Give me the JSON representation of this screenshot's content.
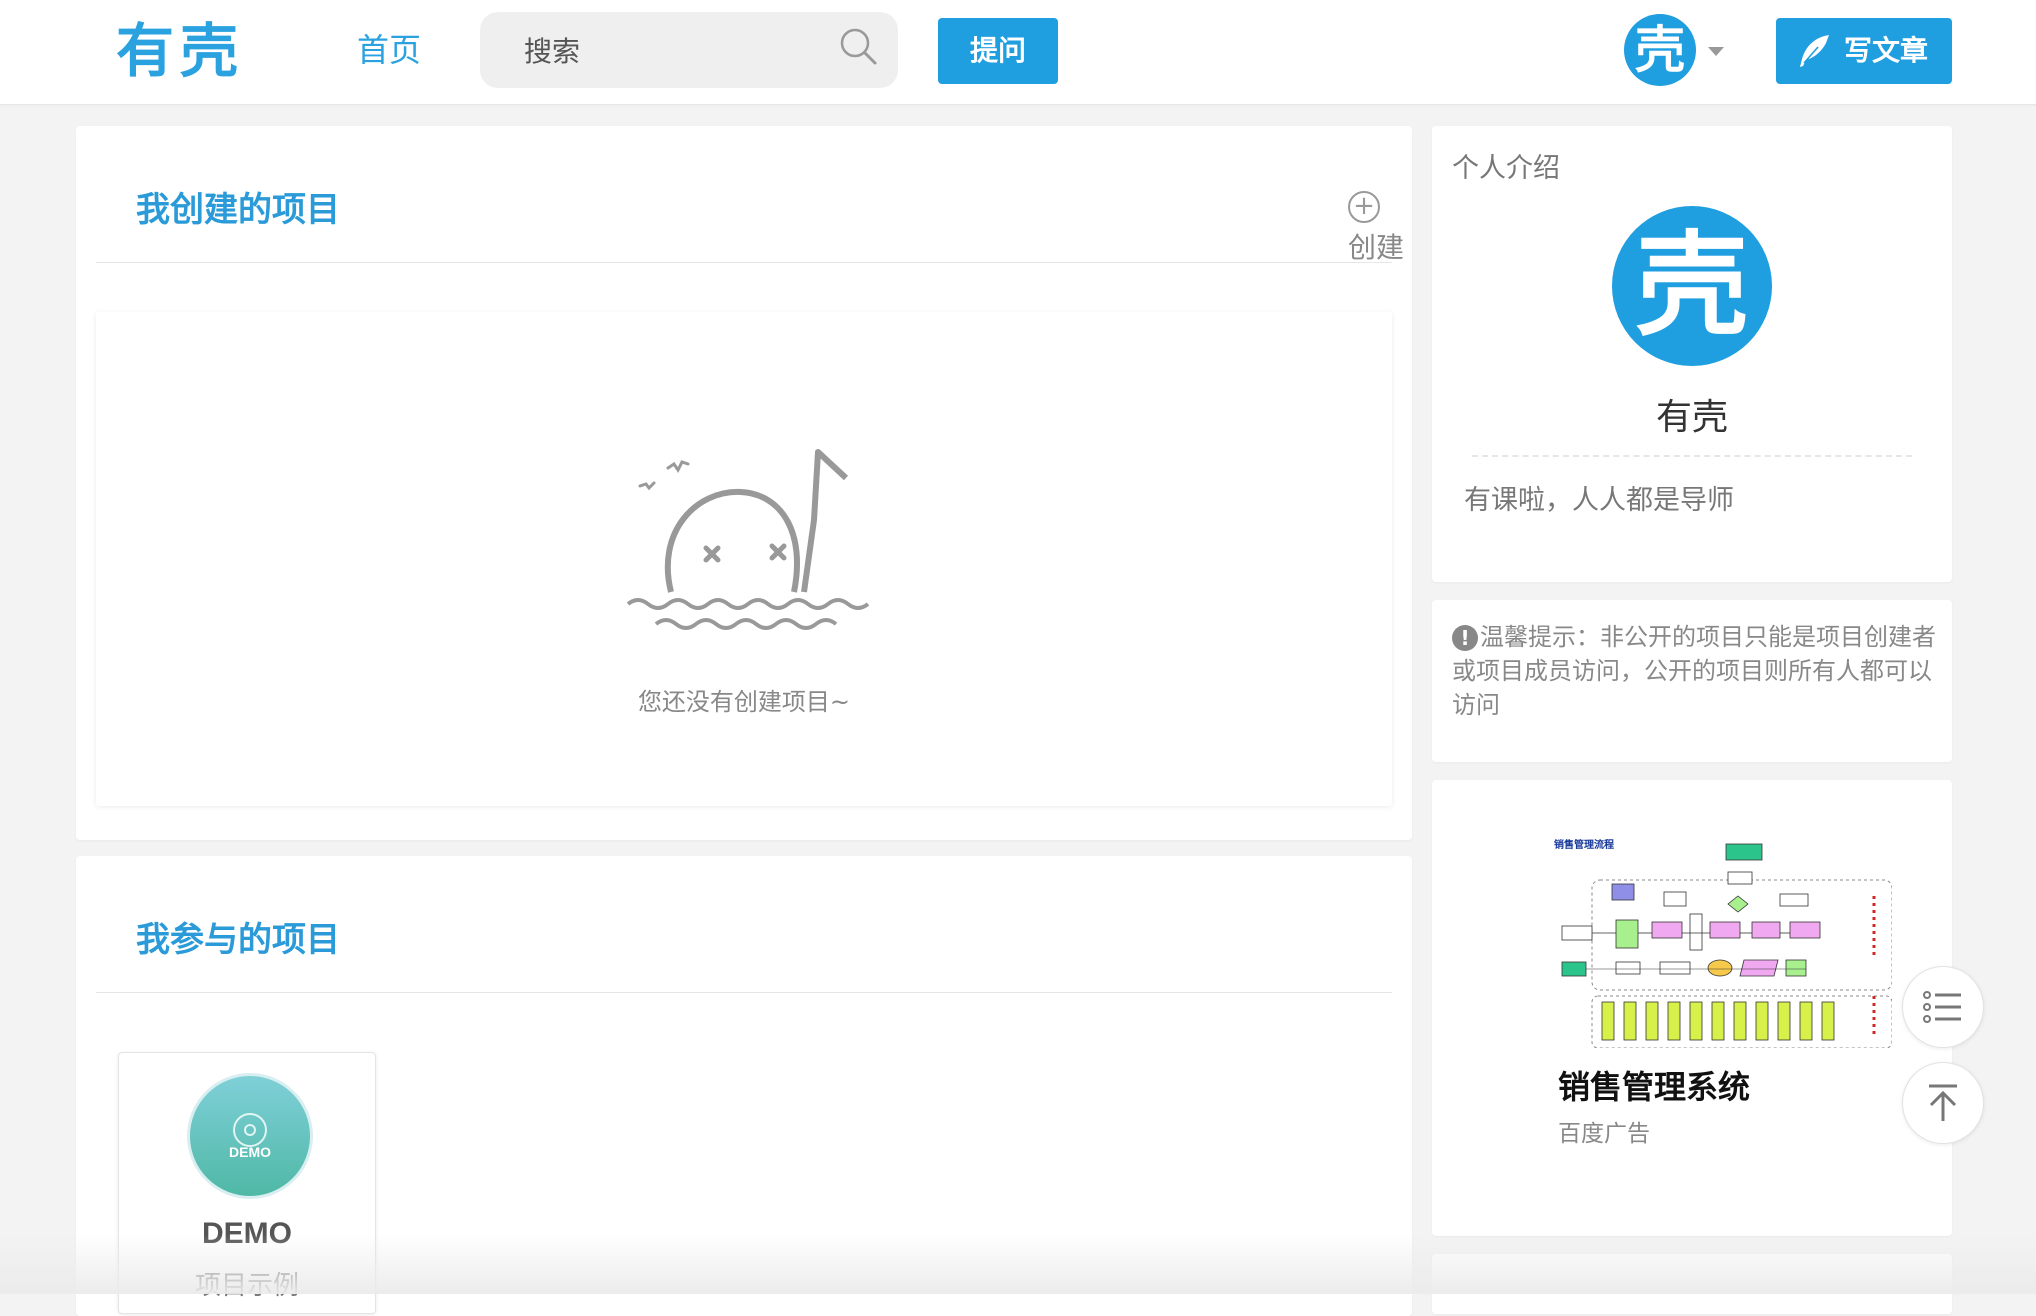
{
  "header": {
    "logo_text": "有壳",
    "nav_home": "首页",
    "search_placeholder": "搜索",
    "ask_button": "提问",
    "avatar_text": "壳",
    "write_button": "写文章"
  },
  "main": {
    "created_section_title": "我创建的项目",
    "create_link": "创建",
    "empty_text": "您还没有创建项目~",
    "joined_section_title": "我参与的项目",
    "projects": [
      {
        "name": "DEMO",
        "desc": "项目示例",
        "logo_text": "DEMO"
      }
    ]
  },
  "sidebar": {
    "intro_title": "个人介绍",
    "avatar_text": "壳",
    "name": "有壳",
    "bio": "有课啦，人人都是导师",
    "tip_icon": "!",
    "tip": "温馨提示：非公开的项目只能是项目创建者或项目成员访问，公开的项目则所有人都可以访问",
    "ad": {
      "image_title": "销售管理流程",
      "title": "销售管理系统",
      "source": "百度广告"
    }
  },
  "icons": {
    "search": "search-icon",
    "feather": "feather-icon",
    "list": "list-icon",
    "back_to_top": "arrow-up-icon"
  },
  "colors": {
    "brand": "#1f9ee0",
    "title": "#2a9ad8",
    "background": "#f3f3f3"
  }
}
